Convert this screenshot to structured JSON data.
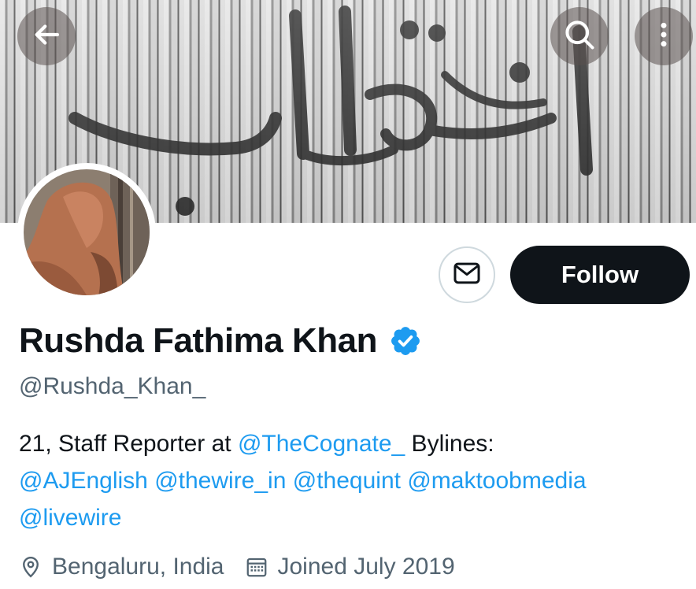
{
  "header": {
    "back_icon": "arrow-left-icon",
    "search_icon": "search-icon",
    "more_icon": "more-vertical-icon"
  },
  "profile": {
    "display_name": "Rushda Fathima Khan",
    "verified_icon": "verified-badge-icon",
    "verified_color": "#1d9bf0",
    "handle": "@Rushda_Khan_",
    "follow_label": "Follow",
    "message_icon": "envelope-icon",
    "bio": {
      "line1_text": "21, Staff Reporter at ",
      "line1_mention": "@TheCognate_",
      "line1_tail": " Bylines:",
      "mentions_line2": [
        "@AJEnglish",
        "@thewire_in",
        "@thequint",
        "@maktoobmedia"
      ],
      "mentions_line3": [
        "@livewire"
      ]
    },
    "location": "Bengaluru, India",
    "location_icon": "location-pin-icon",
    "joined": "Joined July 2019",
    "joined_icon": "calendar-icon"
  },
  "colors": {
    "accent": "#1d9bf0",
    "text_primary": "#0f1419",
    "text_secondary": "#536471",
    "follow_bg": "#0f1419"
  }
}
